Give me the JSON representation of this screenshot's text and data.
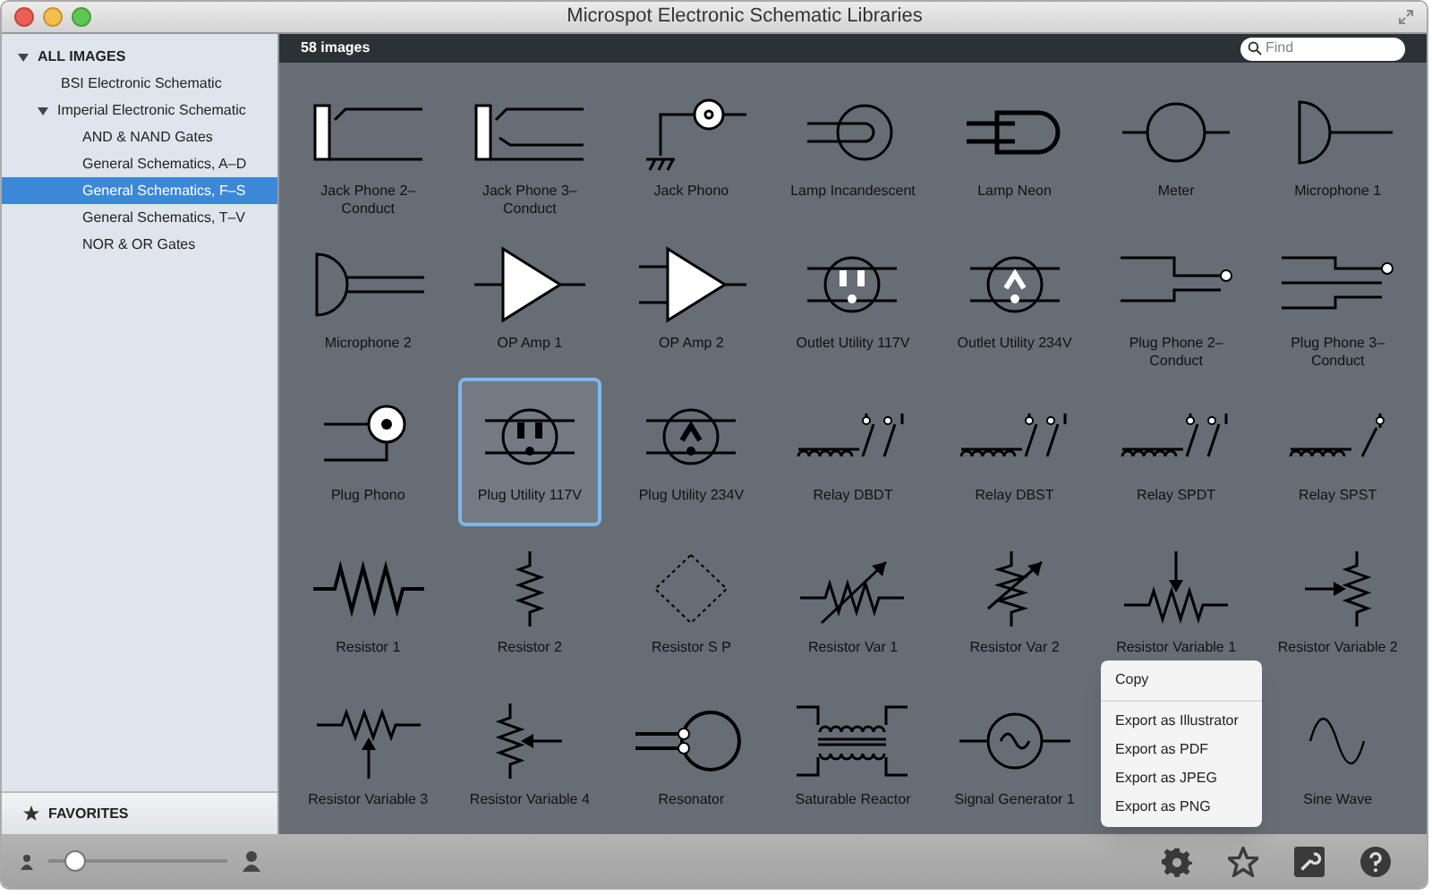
{
  "window": {
    "title": "Microspot Electronic Schematic Libraries"
  },
  "sidebar": {
    "header": "ALL IMAGES",
    "expanded": true,
    "items": [
      {
        "label": "BSI Electronic Schematic",
        "selected": false
      },
      {
        "label": "Imperial Electronic Schematic",
        "selected": false,
        "expanded": true,
        "children": [
          {
            "label": "AND & NAND Gates",
            "selected": false
          },
          {
            "label": "General Schematics, A–D",
            "selected": false
          },
          {
            "label": "General Schematics, F–S",
            "selected": true
          },
          {
            "label": "General Schematics, T–V",
            "selected": false
          },
          {
            "label": "NOR & OR Gates",
            "selected": false
          }
        ]
      }
    ],
    "favorites": "FAVORITES"
  },
  "toolbar": {
    "count": "58 images",
    "search": {
      "placeholder": "Find"
    }
  },
  "images": [
    {
      "label": "Jack Phone 2–Conduct",
      "kind": "jack2",
      "selected": false
    },
    {
      "label": "Jack Phone 3–Conduct",
      "kind": "jack3",
      "selected": false
    },
    {
      "label": "Jack Phono",
      "kind": "jackphono",
      "selected": false
    },
    {
      "label": "Lamp Incandescent",
      "kind": "lamp",
      "selected": false
    },
    {
      "label": "Lamp Neon",
      "kind": "neon",
      "selected": false
    },
    {
      "label": "Meter",
      "kind": "meter",
      "selected": false
    },
    {
      "label": "Microphone 1",
      "kind": "mic1",
      "selected": false
    },
    {
      "label": "Microphone 2",
      "kind": "mic2",
      "selected": false
    },
    {
      "label": "OP Amp 1",
      "kind": "opamp1",
      "selected": false
    },
    {
      "label": "OP Amp 2",
      "kind": "opamp2",
      "selected": false
    },
    {
      "label": "Outlet Utility 117V",
      "kind": "outlet117",
      "selected": false
    },
    {
      "label": "Outlet Utility 234V",
      "kind": "outlet234",
      "selected": false
    },
    {
      "label": "Plug Phone 2–Conduct",
      "kind": "plug2",
      "selected": false
    },
    {
      "label": "Plug Phone 3–Conduct",
      "kind": "plug3",
      "selected": false
    },
    {
      "label": "Plug Phono",
      "kind": "plugphono",
      "selected": false
    },
    {
      "label": "Plug Utility 117V",
      "kind": "plug117",
      "selected": true
    },
    {
      "label": "Plug Utility 234V",
      "kind": "plug234",
      "selected": false
    },
    {
      "label": "Relay DBDT",
      "kind": "relay",
      "selected": false
    },
    {
      "label": "Relay DBST",
      "kind": "relay",
      "selected": false
    },
    {
      "label": "Relay SPDT",
      "kind": "relay",
      "selected": false
    },
    {
      "label": "Relay SPST",
      "kind": "relay1",
      "selected": false
    },
    {
      "label": "Resistor 1",
      "kind": "resistor",
      "selected": false
    },
    {
      "label": "Resistor 2",
      "kind": "resistorv",
      "selected": false
    },
    {
      "label": "Resistor S P",
      "kind": "resistorsp",
      "selected": false
    },
    {
      "label": "Resistor Var 1",
      "kind": "resvar",
      "selected": false
    },
    {
      "label": "Resistor Var 2",
      "kind": "resvarv",
      "selected": false
    },
    {
      "label": "Resistor Variable 1",
      "kind": "pot",
      "selected": false
    },
    {
      "label": "Resistor Variable 2",
      "kind": "potv",
      "selected": false
    },
    {
      "label": "Resistor Variable 3",
      "kind": "pot3",
      "selected": false
    },
    {
      "label": "Resistor Variable 4",
      "kind": "pot4",
      "selected": false
    },
    {
      "label": "Resonator",
      "kind": "resonator",
      "selected": false
    },
    {
      "label": "Saturable Reactor",
      "kind": "reactor",
      "selected": false
    },
    {
      "label": "Signal Generator 1",
      "kind": "siggen",
      "selected": false
    },
    {
      "kind": "hidden"
    },
    {
      "label": "Sine Wave",
      "kind": "sine",
      "selected": false
    }
  ],
  "menu": [
    {
      "label": "Copy",
      "kind": "item"
    },
    {
      "kind": "separator"
    },
    {
      "label": "Export as Illustrator",
      "kind": "item"
    },
    {
      "label": "Export as PDF",
      "kind": "item"
    },
    {
      "label": "Export as JPEG",
      "kind": "item"
    },
    {
      "label": "Export as PNG",
      "kind": "item"
    }
  ],
  "zoom_slider": {
    "level": 0.15
  }
}
